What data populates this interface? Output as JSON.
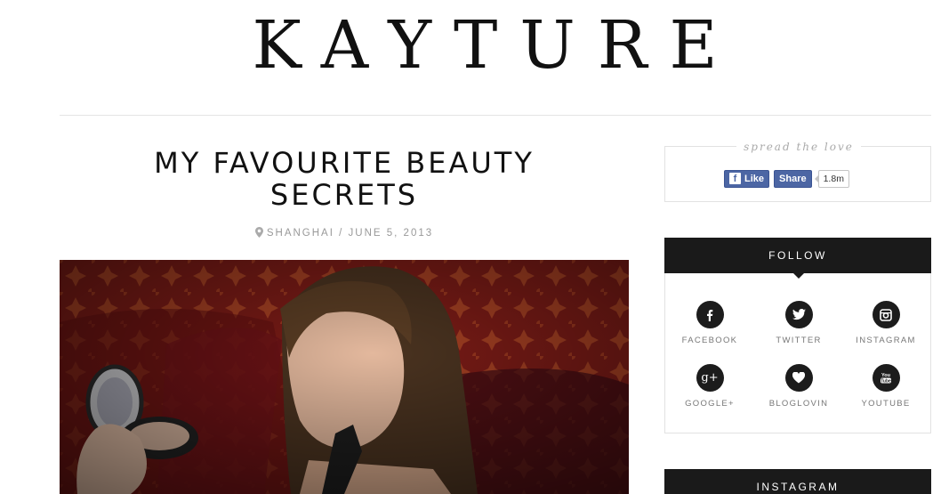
{
  "site": {
    "logo": "KAYTURE"
  },
  "post": {
    "title_line1": "MY FAVOURITE BEAUTY",
    "title_line2": "SECRETS",
    "location": "SHANGHAI",
    "separator": " / ",
    "date": "JUNE 5, 2013"
  },
  "share": {
    "label": "spread the love",
    "like_label": "Like",
    "share_label": "Share",
    "count": "1.8m"
  },
  "follow": {
    "title": "FOLLOW",
    "items": [
      {
        "label": "FACEBOOK",
        "icon": "facebook-icon"
      },
      {
        "label": "TWITTER",
        "icon": "twitter-icon"
      },
      {
        "label": "INSTAGRAM",
        "icon": "instagram-icon"
      },
      {
        "label": "GOOGLE+",
        "icon": "google-plus-icon"
      },
      {
        "label": "BLOGLOVIN",
        "icon": "heart-icon"
      },
      {
        "label": "YOUTUBE",
        "icon": "youtube-icon"
      }
    ]
  },
  "instagram": {
    "title": "INSTAGRAM"
  },
  "colors": {
    "facebook": "#4c66a4",
    "dark": "#1a1a1a",
    "meta": "#999999"
  }
}
